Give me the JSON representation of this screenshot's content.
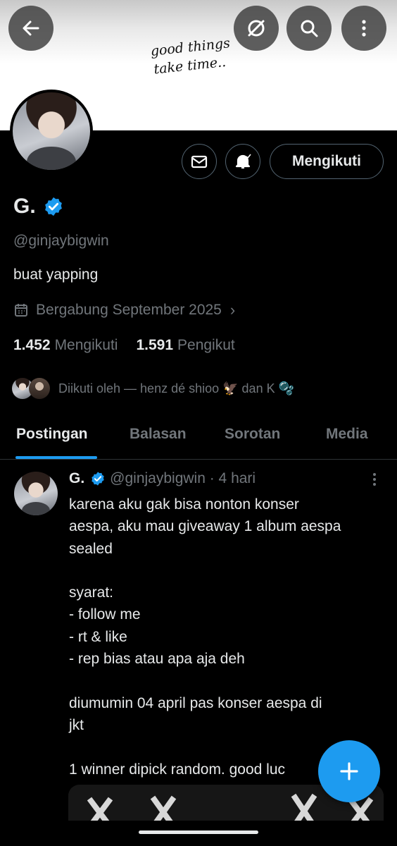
{
  "banner": {
    "line1": "good things",
    "line2": "take time.."
  },
  "profile": {
    "name": "G.",
    "handle": "@ginjaybigwin",
    "bio": "buat yapping",
    "joined": "Bergabung September 2025",
    "following_count": "1.452",
    "following_label": "Mengikuti",
    "followers_count": "1.591",
    "followers_label": "Pengikut",
    "followed_by": "Diikuti oleh — henz dé shioo 🦅 dan K 🫧",
    "follow_button": "Mengikuti"
  },
  "tabs": [
    {
      "label": "Postingan",
      "active": true
    },
    {
      "label": "Balasan"
    },
    {
      "label": "Sorotan"
    },
    {
      "label": "Media"
    }
  ],
  "post": {
    "name": "G.",
    "meta": "@ginjaybigwin · 4 hari",
    "text": "karena aku gak bisa nonton konser\naespa, aku mau giveaway 1 album aespa\nsealed\n\nsyarat:\n- follow me\n- rt & like\n- rep bias atau apa aja deh\n\ndiumumin 04 april pas konser aespa di\njkt\n\n1 winner dipick random. good luc"
  },
  "icons": [
    "back-icon",
    "no-translate-icon",
    "search-icon",
    "more-vertical-icon",
    "mail-icon",
    "bell-icon",
    "verified-icon",
    "calendar-icon",
    "compose-plus-icon"
  ],
  "colors": {
    "accent": "#1d9bf0",
    "background": "#000000",
    "muted": "#71767b"
  }
}
